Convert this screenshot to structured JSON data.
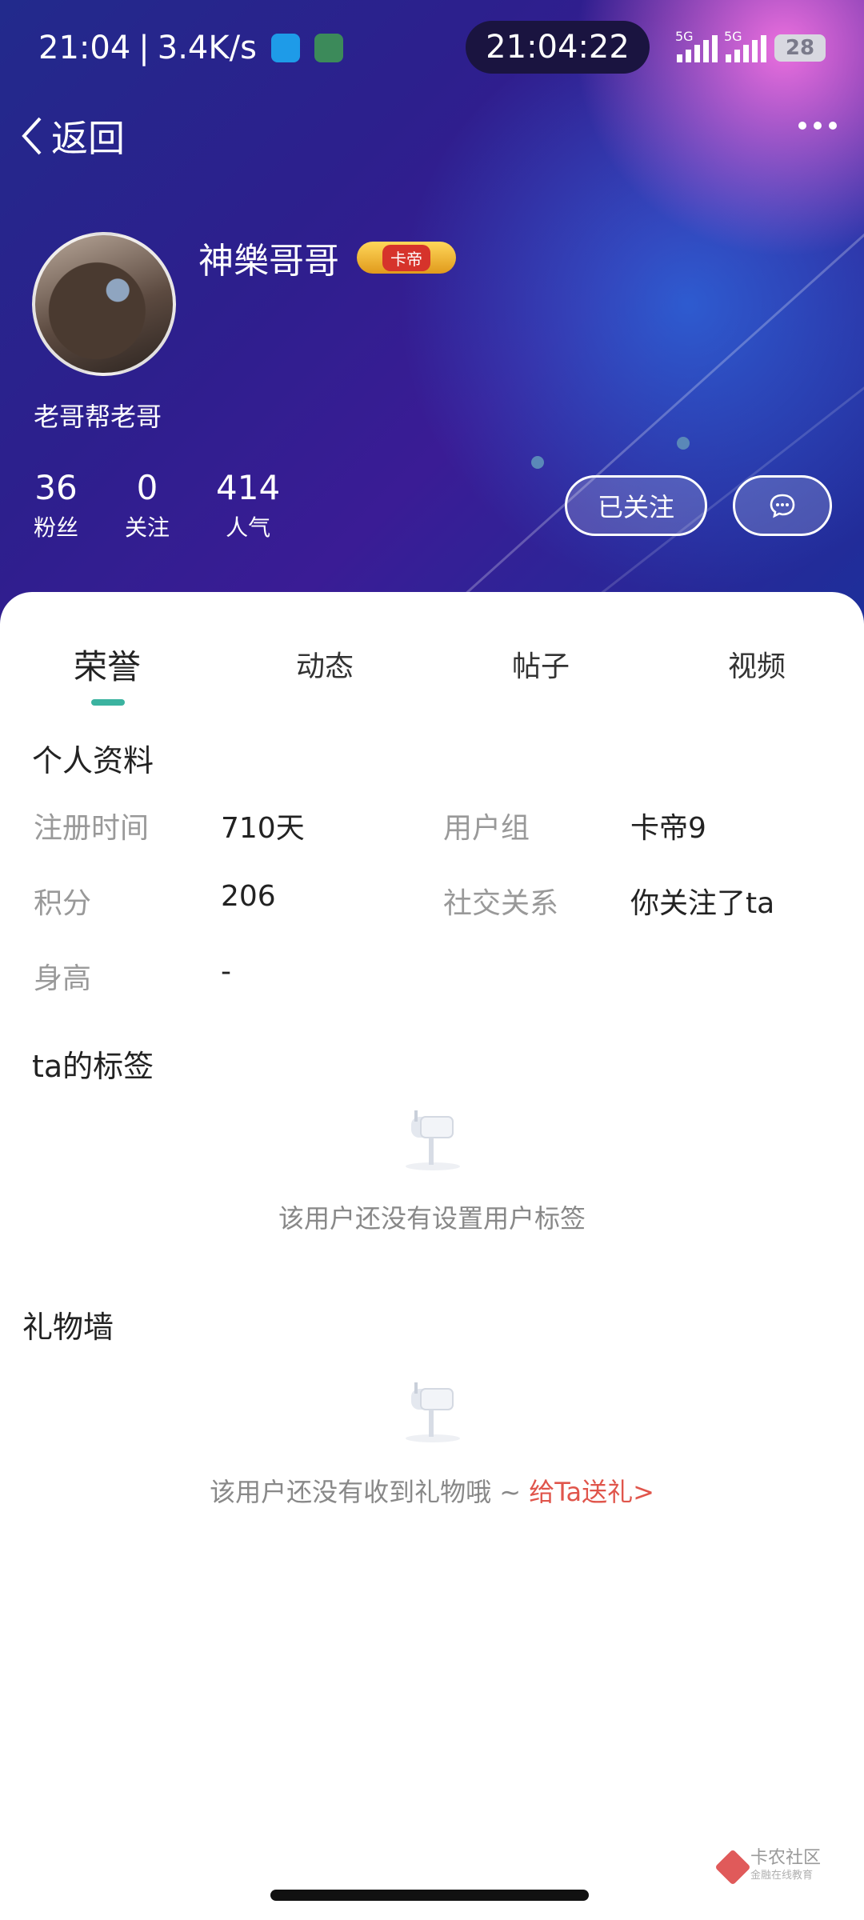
{
  "status_bar": {
    "time": "21:04",
    "speed": "3.4K/s",
    "clock": "21:04:22",
    "net1": "5G",
    "net2": "5G",
    "battery": "28"
  },
  "nav": {
    "back_label": "返回"
  },
  "profile": {
    "username": "神樂哥哥",
    "badge": "卡帝",
    "bio": "老哥帮老哥",
    "stats": [
      {
        "value": "36",
        "label": "粉丝"
      },
      {
        "value": "0",
        "label": "关注"
      },
      {
        "value": "414",
        "label": "人气"
      }
    ],
    "follow_label": "已关注"
  },
  "tabs": [
    "荣誉",
    "动态",
    "帖子",
    "视频"
  ],
  "personal_info": {
    "title": "个人资料",
    "fields": [
      {
        "label": "注册时间",
        "value": "710天"
      },
      {
        "label": "用户组",
        "value": "卡帝9"
      },
      {
        "label": "积分",
        "value": "206"
      },
      {
        "label": "社交关系",
        "value": "你关注了ta"
      },
      {
        "label": "身高",
        "value": "-"
      }
    ]
  },
  "tags": {
    "title": "ta的标签",
    "empty_text": "该用户还没有设置用户标签"
  },
  "gifts": {
    "title": "礼物墙",
    "empty_text": "该用户还没有收到礼物哦 ~ ",
    "link": "给Ta送礼>"
  },
  "watermark": {
    "name": "卡农社区",
    "sub": "金融在线教育"
  },
  "colors": {
    "accent": "#3bb3a0",
    "link": "#e0554b",
    "hero_dark": "#2d1f8d"
  }
}
